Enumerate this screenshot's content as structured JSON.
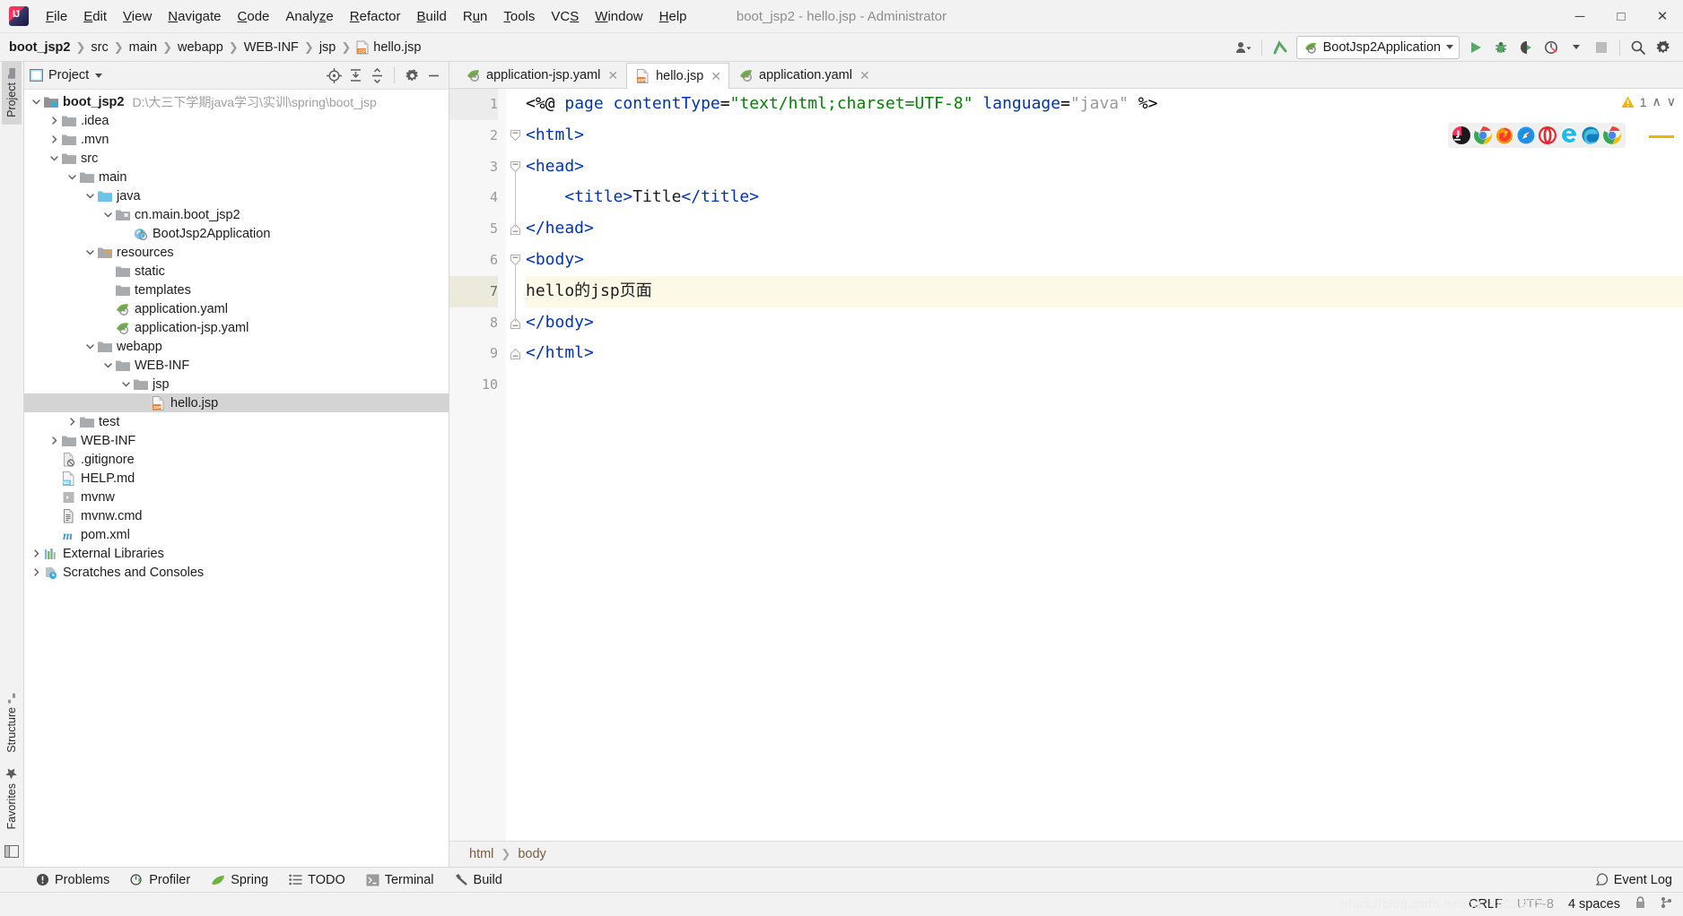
{
  "window": {
    "title": "boot_jsp2 - hello.jsp - Administrator",
    "minimize": "─",
    "maximize": "☐",
    "close": "✕"
  },
  "menu": {
    "items": [
      "File",
      "Edit",
      "View",
      "Navigate",
      "Code",
      "Analyze",
      "Refactor",
      "Build",
      "Run",
      "Tools",
      "VCS",
      "Window",
      "Help"
    ]
  },
  "navbar": {
    "breadcrumb": [
      "boot_jsp2",
      "src",
      "main",
      "webapp",
      "WEB-INF",
      "jsp",
      "hello.jsp"
    ],
    "run_config": "BootJsp2Application",
    "icons": [
      "user-settings-icon",
      "updates-icon",
      "run-icon",
      "debug-icon",
      "run-coverage-icon",
      "profiler-icon",
      "stop-icon",
      "search-everywhere-icon",
      "settings-icon"
    ]
  },
  "left_rail": {
    "tabs": [
      "Project",
      "Structure",
      "Favorites"
    ]
  },
  "project_panel": {
    "title": "Project",
    "toolbar_icons": [
      "locate-icon",
      "expand-all-icon",
      "collapse-all-icon",
      "gear-icon",
      "hide-icon"
    ],
    "tree": [
      {
        "depth": 0,
        "arrow": "down",
        "icon": "module-folder",
        "label": "boot_jsp2",
        "bold": true,
        "path": "D:\\大三下学期java学习\\实训\\spring\\boot_jsp",
        "selected": false
      },
      {
        "depth": 1,
        "arrow": "right",
        "icon": "folder",
        "label": ".idea",
        "selected": false
      },
      {
        "depth": 1,
        "arrow": "right",
        "icon": "folder",
        "label": ".mvn",
        "selected": false
      },
      {
        "depth": 1,
        "arrow": "down",
        "icon": "folder",
        "label": "src",
        "selected": false
      },
      {
        "depth": 2,
        "arrow": "down",
        "icon": "folder",
        "label": "main",
        "selected": false
      },
      {
        "depth": 3,
        "arrow": "down",
        "icon": "source-folder",
        "label": "java",
        "selected": false
      },
      {
        "depth": 4,
        "arrow": "down",
        "icon": "package",
        "label": "cn.main.boot_jsp2",
        "selected": false
      },
      {
        "depth": 5,
        "arrow": "none",
        "icon": "spring-class",
        "label": "BootJsp2Application",
        "selected": false
      },
      {
        "depth": 3,
        "arrow": "down",
        "icon": "resource-folder",
        "label": "resources",
        "selected": false
      },
      {
        "depth": 4,
        "arrow": "none",
        "icon": "folder",
        "label": "static",
        "selected": false
      },
      {
        "depth": 4,
        "arrow": "none",
        "icon": "folder",
        "label": "templates",
        "selected": false
      },
      {
        "depth": 4,
        "arrow": "none",
        "icon": "spring-yaml",
        "label": "application.yaml",
        "selected": false
      },
      {
        "depth": 4,
        "arrow": "none",
        "icon": "spring-yaml",
        "label": "application-jsp.yaml",
        "selected": false
      },
      {
        "depth": 3,
        "arrow": "down",
        "icon": "folder",
        "label": "webapp",
        "selected": false
      },
      {
        "depth": 4,
        "arrow": "down",
        "icon": "folder",
        "label": "WEB-INF",
        "selected": false
      },
      {
        "depth": 5,
        "arrow": "down",
        "icon": "folder",
        "label": "jsp",
        "selected": false
      },
      {
        "depth": 6,
        "arrow": "none",
        "icon": "jsp-file",
        "label": "hello.jsp",
        "selected": true
      },
      {
        "depth": 2,
        "arrow": "right",
        "icon": "folder",
        "label": "test",
        "selected": false
      },
      {
        "depth": 1,
        "arrow": "right",
        "icon": "folder",
        "label": "WEB-INF",
        "selected": false
      },
      {
        "depth": 1,
        "arrow": "none",
        "icon": "gitignore-file",
        "label": ".gitignore",
        "selected": false
      },
      {
        "depth": 1,
        "arrow": "none",
        "icon": "md-file",
        "label": "HELP.md",
        "selected": false
      },
      {
        "depth": 1,
        "arrow": "none",
        "icon": "script-file",
        "label": "mvnw",
        "selected": false
      },
      {
        "depth": 1,
        "arrow": "none",
        "icon": "text-file",
        "label": "mvnw.cmd",
        "selected": false
      },
      {
        "depth": 1,
        "arrow": "none",
        "icon": "maven-file",
        "label": "pom.xml",
        "selected": false
      },
      {
        "depth": 0,
        "arrow": "right",
        "icon": "libraries",
        "label": "External Libraries",
        "selected": false
      },
      {
        "depth": 0,
        "arrow": "right",
        "icon": "scratches",
        "label": "Scratches and Consoles",
        "selected": false
      }
    ]
  },
  "editor": {
    "tabs": [
      {
        "label": "application-jsp.yaml",
        "icon": "spring-yaml",
        "active": false,
        "close": "✕"
      },
      {
        "label": "hello.jsp",
        "icon": "jsp-file",
        "active": true,
        "close": "✕"
      },
      {
        "label": "application.yaml",
        "icon": "spring-yaml",
        "active": false,
        "close": "✕"
      }
    ],
    "gutter_numbers": [
      "1",
      "2",
      "3",
      "4",
      "5",
      "6",
      "7",
      "8",
      "9",
      "10"
    ],
    "current_line": 7,
    "inspections": {
      "warning_count": "1",
      "up": "∧",
      "down": "∨"
    },
    "browsers": [
      "intellij",
      "chrome",
      "firefox",
      "safari",
      "opera",
      "ie",
      "edge",
      "chrome-canary"
    ],
    "lines": [
      {
        "n": 1,
        "segments": [
          {
            "t": "<%@ ",
            "c": "op"
          },
          {
            "t": "page ",
            "c": "tag"
          },
          {
            "t": "contentType",
            "c": "attr"
          },
          {
            "t": "=",
            "c": "op"
          },
          {
            "t": "\"text/html;charset=UTF-8\"",
            "c": "str"
          },
          {
            "t": " ",
            "c": "op"
          },
          {
            "t": "language",
            "c": "attr"
          },
          {
            "t": "=",
            "c": "op"
          },
          {
            "t": "\"java\"",
            "c": "str-dim"
          },
          {
            "t": " %>",
            "c": "op"
          }
        ]
      },
      {
        "n": 2,
        "segments": [
          {
            "t": "<html>",
            "c": "tag"
          }
        ]
      },
      {
        "n": 3,
        "segments": [
          {
            "t": "<head>",
            "c": "tag"
          }
        ]
      },
      {
        "n": 4,
        "segments": [
          {
            "t": "    ",
            "c": "op"
          },
          {
            "t": "<title>",
            "c": "tag"
          },
          {
            "t": "Title",
            "c": "txt"
          },
          {
            "t": "</title>",
            "c": "tag"
          }
        ]
      },
      {
        "n": 5,
        "segments": [
          {
            "t": "</head>",
            "c": "tag"
          }
        ]
      },
      {
        "n": 6,
        "segments": [
          {
            "t": "<body>",
            "c": "tag"
          }
        ]
      },
      {
        "n": 7,
        "segments": [
          {
            "t": "hello的jsp页面",
            "c": "txt"
          }
        ]
      },
      {
        "n": 8,
        "segments": [
          {
            "t": "</body>",
            "c": "tag"
          }
        ]
      },
      {
        "n": 9,
        "segments": [
          {
            "t": "</html>",
            "c": "tag"
          }
        ]
      },
      {
        "n": 10,
        "segments": []
      }
    ],
    "breadcrumb": [
      "html",
      "body"
    ]
  },
  "bottom_tools": {
    "tabs": [
      {
        "label": "Problems",
        "icon": "problems-icon"
      },
      {
        "label": "Profiler",
        "icon": "profiler-icon"
      },
      {
        "label": "Spring",
        "icon": "spring-icon"
      },
      {
        "label": "TODO",
        "icon": "todo-icon"
      },
      {
        "label": "Terminal",
        "icon": "terminal-icon"
      },
      {
        "label": "Build",
        "icon": "build-icon"
      }
    ],
    "event_log": "Event Log"
  },
  "status_bar": {
    "line_sep": "CRLF",
    "encoding": "UTF-8",
    "indent": "4 spaces",
    "watermark": "https://blog.csdn.net/qq_48033003"
  },
  "colors": {
    "accent_green": "#59a869",
    "warning": "#f0b400",
    "tag_blue": "#0033b3",
    "string_green": "#008000",
    "current_line": "#fcfae7",
    "selection_bg": "#d4d4d4"
  }
}
